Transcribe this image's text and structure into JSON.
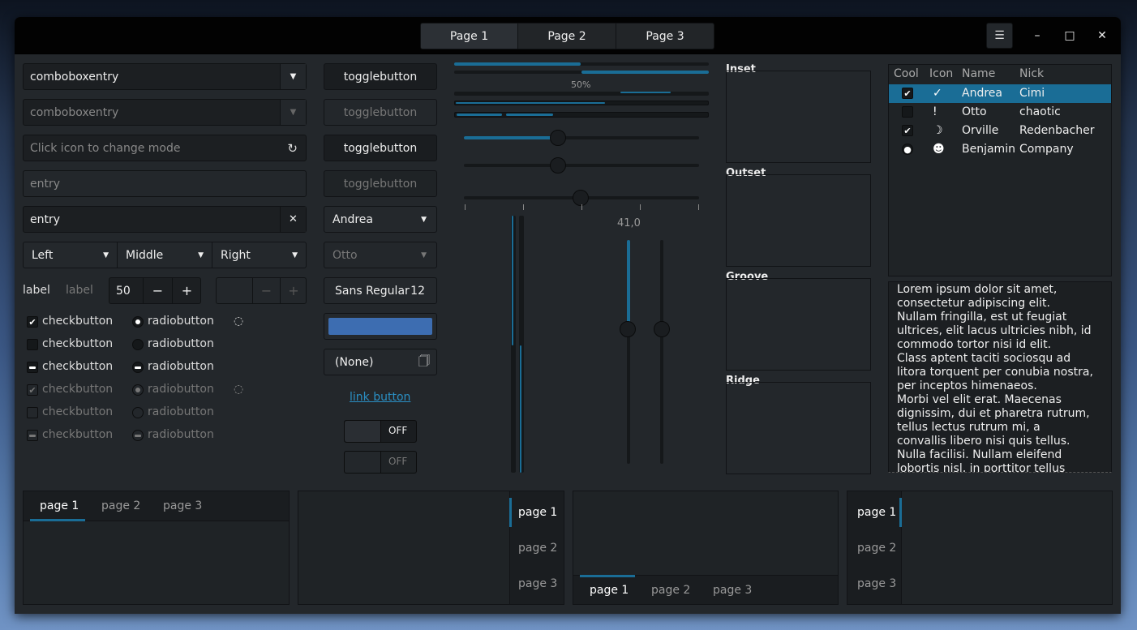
{
  "header": {
    "stack_tabs": [
      "Page 1",
      "Page 2",
      "Page 3"
    ],
    "menu_icon": "☰",
    "minimize_icon": "–",
    "maximize_icon": "□",
    "close_icon": "✕"
  },
  "col1": {
    "combo1": "comboboxentry",
    "combo2": "comboboxentry",
    "mode_entry_placeholder": "Click icon to change mode",
    "entry_dim_placeholder": "entry",
    "entry_clear_value": "entry",
    "dropdowns": [
      "Left",
      "Middle",
      "Right"
    ],
    "label1": "label",
    "label2": "label",
    "spin_value": "50",
    "spin_minus": "−",
    "spin_plus": "+",
    "check_label": "checkbutton",
    "radio_label": "radiobutton"
  },
  "col2": {
    "toggle_label": "togglebutton",
    "combo_andrea": "Andrea",
    "combo_otto": "Otto",
    "font_name": "Sans Regular",
    "font_size": "12",
    "color_value": "#3d6db1",
    "file_chooser": "(None)",
    "link": "link button",
    "switch1": "OFF",
    "switch2": "OFF"
  },
  "col3": {
    "progress_label": "50%",
    "scale_value": "41,0",
    "progress": [
      0.5,
      1.0,
      0.59,
      0.41,
      0.59
    ]
  },
  "frames": [
    "Inset",
    "Outset",
    "Groove",
    "Ridge"
  ],
  "tree": {
    "headers": [
      "Cool",
      "Icon",
      "Name",
      "Nick"
    ],
    "rows": [
      {
        "check": "✔",
        "icon": "check-circle-icon",
        "glyph": "✓",
        "name": "Andrea",
        "nick": "Cimi"
      },
      {
        "check": "",
        "icon": "exclamation-circle-icon",
        "glyph": "!",
        "name": "Otto",
        "nick": "chaotic"
      },
      {
        "check": "✔",
        "icon": "moon-icon",
        "glyph": "☽",
        "name": "Orville",
        "nick": "Redenbacher"
      },
      {
        "check": "●",
        "icon": "face-icon",
        "glyph": "☻",
        "name": "Benjamin",
        "nick": "Company"
      }
    ]
  },
  "textview": "Lorem ipsum dolor sit amet, consectetur adipiscing elit.\nNullam fringilla, est ut feugiat ultrices, elit lacus ultricies nibh, id commodo tortor nisi id elit.\nClass aptent taciti sociosqu ad litora torquent per conubia nostra, per inceptos himenaeos.\nMorbi vel elit erat. Maecenas dignissim, dui et pharetra rutrum, tellus lectus rutrum mi, a convallis libero nisi quis tellus.\nNulla facilisi. Nullam eleifend lobortis nisl, in porttitor tellus",
  "notebooks": [
    "page 1",
    "page 2",
    "page 3"
  ],
  "accent": "#1a6d96"
}
